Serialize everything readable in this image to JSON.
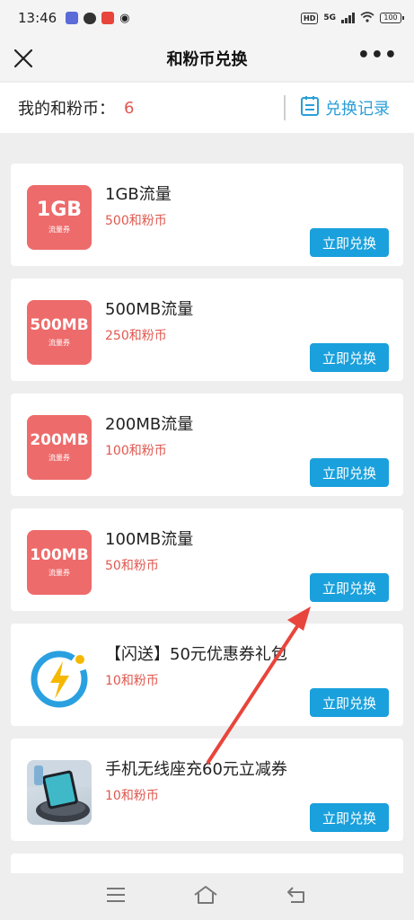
{
  "status_bar": {
    "time": "13:46",
    "network": "5G",
    "hd_tag": "HD",
    "battery": "100"
  },
  "nav": {
    "title": "和粉币兑换"
  },
  "coins": {
    "label": "我的和粉币：",
    "value": "6",
    "history_label": "兑换记录"
  },
  "items": [
    {
      "title": "1GB流量",
      "price": "500和粉币",
      "badge": "1GB",
      "badge_sub": "流量券",
      "button": "立即兑换"
    },
    {
      "title": "500MB流量",
      "price": "250和粉币",
      "badge": "500MB",
      "badge_sub": "流量券",
      "button": "立即兑换"
    },
    {
      "title": "200MB流量",
      "price": "100和粉币",
      "badge": "200MB",
      "badge_sub": "流量券",
      "button": "立即兑换"
    },
    {
      "title": "100MB流量",
      "price": "50和粉币",
      "badge": "100MB",
      "badge_sub": "流量券",
      "button": "立即兑换"
    },
    {
      "title": "【闪送】50元优惠券礼包",
      "price": "10和粉币",
      "button": "立即兑换",
      "icon": "flash-delivery-logo"
    },
    {
      "title": "手机无线座充60元立减券",
      "price": "10和粉币",
      "button": "立即兑换",
      "icon": "wireless-charger-photo"
    }
  ],
  "colors": {
    "accent": "#1aa0dc",
    "price": "#e0584f",
    "badge": "#ee6b6b",
    "annotation_arrow": "#e8453c"
  }
}
